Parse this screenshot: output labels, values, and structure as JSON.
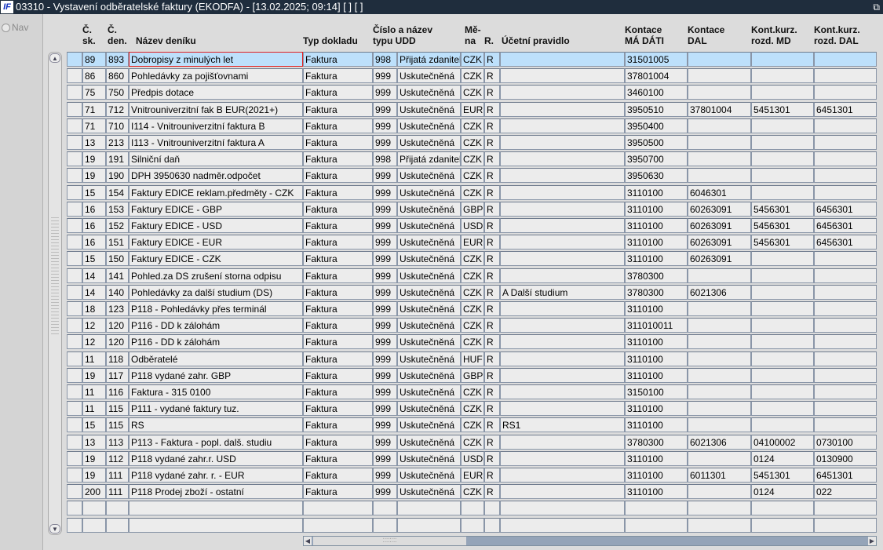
{
  "window": {
    "title": "03310 - Vystavení odběratelské faktury (EKODFA) - [13.02.2025; 09:14]  [ ]  [ ]",
    "logo": "IF",
    "restore_icon": "⧉"
  },
  "left": {
    "nav_label": "Nav"
  },
  "columns": [
    {
      "l1": "Č.",
      "l2": "sk."
    },
    {
      "l1": "Č.",
      "l2": "den."
    },
    {
      "l1": "",
      "l2": "Název deníku"
    },
    {
      "l1": "",
      "l2": "Typ dokladu"
    },
    {
      "l1": "Číslo a název",
      "l2": "typu UDD"
    },
    {
      "l1": "Mě-",
      "l2": "na"
    },
    {
      "l1": "",
      "l2": "R."
    },
    {
      "l1": "",
      "l2": "Účetní pravidlo"
    },
    {
      "l1": "Kontace",
      "l2": "MÁ DÁTI"
    },
    {
      "l1": "Kontace",
      "l2": "DAL"
    },
    {
      "l1": "Kont.kurz.",
      "l2": "rozd. MD"
    },
    {
      "l1": "Kont.kurz.",
      "l2": "rozd. DAL"
    }
  ],
  "rows": [
    [
      "89",
      "893",
      "Dobropisy z minulých let",
      "Faktura",
      "998",
      "Přijatá zdanitelné",
      "CZK",
      "R",
      "",
      "31501005",
      "",
      "",
      ""
    ],
    [
      "86",
      "860",
      "Pohledávky za pojišťovnami",
      "Faktura",
      "999",
      "Uskutečněná",
      "CZK",
      "R",
      "",
      "37801004",
      "",
      "",
      ""
    ],
    [
      "75",
      "750",
      "Předpis dotace",
      "Faktura",
      "999",
      "Uskutečněná",
      "CZK",
      "R",
      "",
      "3460100",
      "",
      "",
      ""
    ],
    [
      "71",
      "712",
      "Vnitrouniverzitní fak B EUR(2021+)",
      "Faktura",
      "999",
      "Uskutečněná",
      "EUR",
      "R",
      "",
      "3950510",
      "37801004",
      "5451301",
      "6451301"
    ],
    [
      "71",
      "710",
      "I114 - Vnitrouniverzitní faktura  B",
      "Faktura",
      "999",
      "Uskutečněná",
      "CZK",
      "R",
      "",
      "3950400",
      "",
      "",
      ""
    ],
    [
      "13",
      "213",
      "I113 - Vnitrouniverzitní faktura  A",
      "Faktura",
      "999",
      "Uskutečněná",
      "CZK",
      "R",
      "",
      "3950500",
      "",
      "",
      ""
    ],
    [
      "19",
      "191",
      "Silniční daň",
      "Faktura",
      "998",
      "Přijatá zdanitelné",
      "CZK",
      "R",
      "",
      "3950700",
      "",
      "",
      ""
    ],
    [
      "19",
      "190",
      "DPH            3950630 nadměr.odpočet",
      "Faktura",
      "999",
      "Uskutečněná",
      "CZK",
      "R",
      "",
      "3950630",
      "",
      "",
      ""
    ],
    [
      "15",
      "154",
      "Faktury EDICE reklam.předměty - CZK",
      "Faktura",
      "999",
      "Uskutečněná",
      "CZK",
      "R",
      "",
      "3110100",
      "6046301",
      "",
      ""
    ],
    [
      "16",
      "153",
      "Faktury EDICE - GBP",
      "Faktura",
      "999",
      "Uskutečněná",
      "GBP",
      "R",
      "",
      "3110100",
      "60263091",
      "5456301",
      "6456301"
    ],
    [
      "16",
      "152",
      "Faktury EDICE - USD",
      "Faktura",
      "999",
      "Uskutečněná",
      "USD",
      "R",
      "",
      "3110100",
      "60263091",
      "5456301",
      "6456301"
    ],
    [
      "16",
      "151",
      "Faktury EDICE - EUR",
      "Faktura",
      "999",
      "Uskutečněná",
      "EUR",
      "R",
      "",
      "3110100",
      "60263091",
      "5456301",
      "6456301"
    ],
    [
      "15",
      "150",
      "Faktury EDICE - CZK",
      "Faktura",
      "999",
      "Uskutečněná",
      "CZK",
      "R",
      "",
      "3110100",
      "60263091",
      "",
      ""
    ],
    [
      "14",
      "141",
      "Pohled.za DS zrušení storna odpisu",
      "Faktura",
      "999",
      "Uskutečněná",
      "CZK",
      "R",
      "",
      "3780300",
      "",
      "",
      ""
    ],
    [
      "14",
      "140",
      "Pohledávky za další studium (DS)",
      "Faktura",
      "999",
      "Uskutečněná",
      "CZK",
      "R",
      "A Další studium",
      "3780300",
      "6021306",
      "",
      ""
    ],
    [
      "18",
      "123",
      "P118 - Pohledávky přes terminál",
      "Faktura",
      "999",
      "Uskutečněná",
      "CZK",
      "R",
      "",
      "3110100",
      "",
      "",
      ""
    ],
    [
      "12",
      "120",
      "P116 - DD k zálohám",
      "Faktura",
      "999",
      "Uskutečněná",
      "CZK",
      "R",
      "",
      "311010011",
      "",
      "",
      ""
    ],
    [
      "12",
      "120",
      "P116 - DD k zálohám",
      "Faktura",
      "999",
      "Uskutečněná",
      "CZK",
      "R",
      "",
      "3110100",
      "",
      "",
      ""
    ],
    [
      "11",
      "118",
      "Odběratelé",
      "Faktura",
      "999",
      "Uskutečněná",
      "HUF",
      "R",
      "",
      "3110100",
      "",
      "",
      ""
    ],
    [
      "19",
      "117",
      "P118 vydané zahr. GBP",
      "Faktura",
      "999",
      "Uskutečněná",
      "GBP",
      "R",
      "",
      "3110100",
      "",
      "",
      ""
    ],
    [
      "11",
      "116",
      "Faktura - 315 0100",
      "Faktura",
      "999",
      "Uskutečněná",
      "CZK",
      "R",
      "",
      "3150100",
      "",
      "",
      ""
    ],
    [
      "11",
      "115",
      "P111 - vydané faktury tuz.",
      "Faktura",
      "999",
      "Uskutečněná",
      "CZK",
      "R",
      "",
      "3110100",
      "",
      "",
      ""
    ],
    [
      "15",
      "115",
      "RS",
      "Faktura",
      "999",
      "Uskutečněná",
      "CZK",
      "R",
      "RS1",
      "3110100",
      "",
      "",
      ""
    ],
    [
      "13",
      "113",
      "P113 - Faktura - popl. dalš. studiu",
      "Faktura",
      "999",
      "Uskutečněná",
      "CZK",
      "R",
      "",
      "3780300",
      "6021306",
      "04100002",
      "0730100"
    ],
    [
      "19",
      "112",
      "P118 vydané zahr.r. USD",
      "Faktura",
      "999",
      "Uskutečněná",
      "USD",
      "R",
      "",
      "3110100",
      "",
      "0124",
      "0130900"
    ],
    [
      "19",
      "111",
      "P118 vydané zahr. r. - EUR",
      "Faktura",
      "999",
      "Uskutečněná",
      "EUR",
      "R",
      "",
      "3110100",
      "6011301",
      "5451301",
      "6451301"
    ],
    [
      "200",
      "111",
      "P118 Prodej zboží - ostatní",
      "Faktura",
      "999",
      "Uskutečněná",
      "CZK",
      "R",
      "",
      "3110100",
      "",
      "0124",
      "022"
    ],
    [
      "",
      "",
      "",
      "",
      "",
      "",
      "",
      "",
      "",
      "",
      "",
      "",
      ""
    ],
    [
      "",
      "",
      "",
      "",
      "",
      "",
      "",
      "",
      "",
      "",
      "",
      "",
      ""
    ]
  ],
  "scroll": {
    "up": "▲",
    "down": "▼",
    "left": "◀",
    "right": "▶",
    "grip": "⁚⁚⁚⁚⁚⁚⁚⁚"
  }
}
